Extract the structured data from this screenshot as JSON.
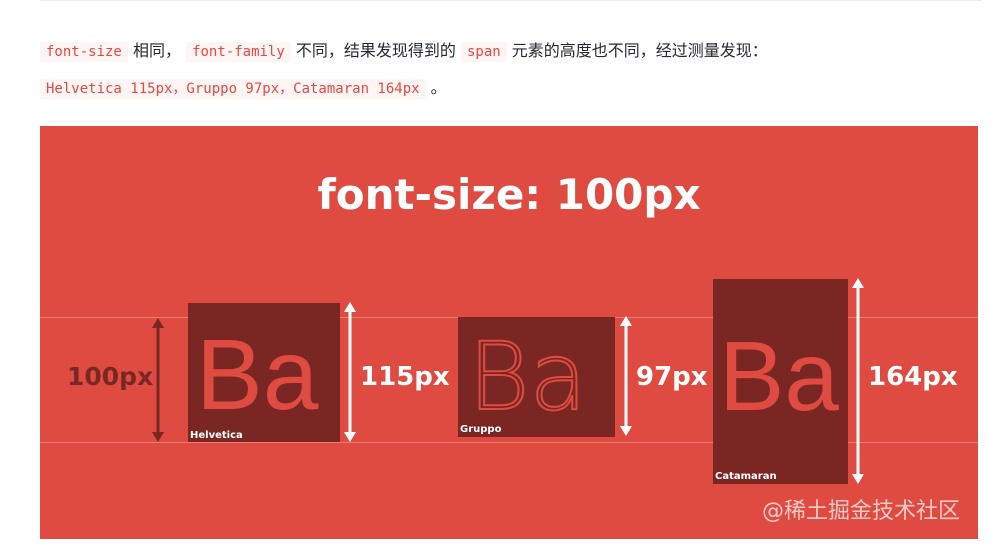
{
  "paragraph": {
    "code1": "font-size",
    "text1": "相同，",
    "code2": "font-family",
    "text2": "不同，结果发现得到的",
    "code3": "span",
    "text3": "元素的高度也不同，经过测量发现：",
    "code4": "Helvetica 115px，Gruppo 97px，Catamaran 164px",
    "text4": "。"
  },
  "figure": {
    "title": "font-size: 100px",
    "reference_label": "100px",
    "sample_text": "Ba",
    "samples": [
      {
        "font_name": "Helvetica",
        "height_label": "115px"
      },
      {
        "font_name": "Gruppo",
        "height_label": "97px"
      },
      {
        "font_name": "Catamaran",
        "height_label": "164px"
      }
    ],
    "watermark": "@稀土掘金技术社区",
    "colors": {
      "background": "#df4b41",
      "box": "#7a2723",
      "text": "#ffffff"
    }
  }
}
